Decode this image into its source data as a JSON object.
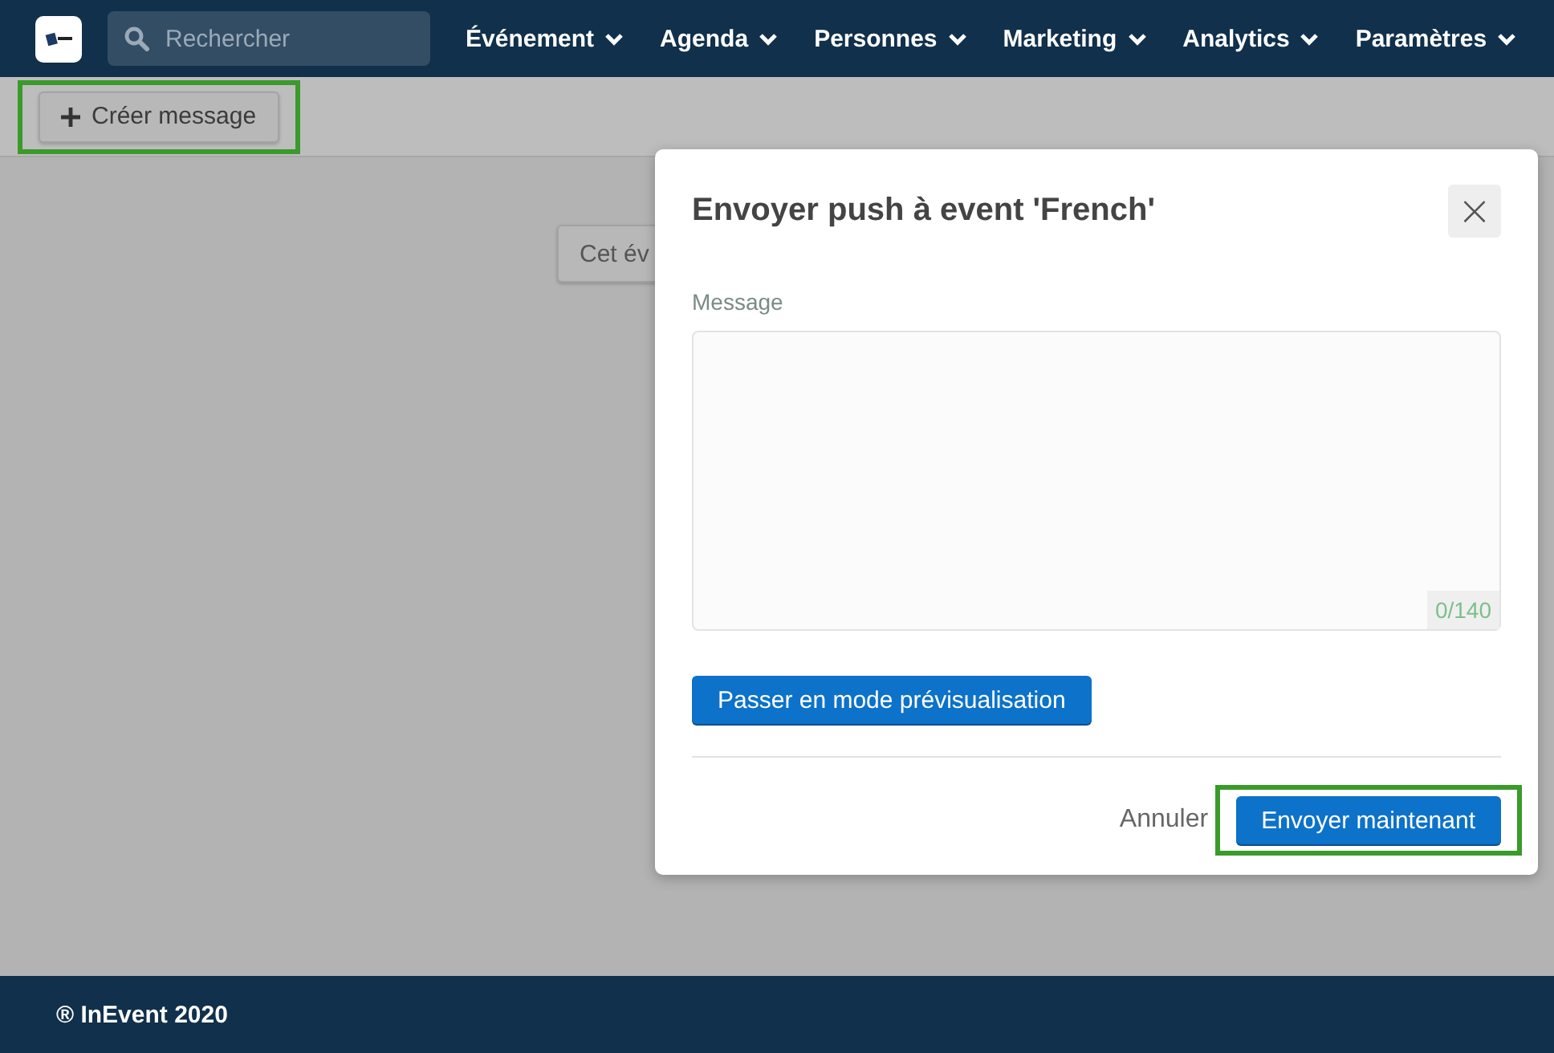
{
  "navbar": {
    "search": {
      "placeholder": "Rechercher"
    },
    "menus": [
      {
        "label": "Événement"
      },
      {
        "label": "Agenda"
      },
      {
        "label": "Personnes"
      },
      {
        "label": "Marketing"
      },
      {
        "label": "Analytics"
      },
      {
        "label": "Paramètres"
      }
    ]
  },
  "toolbar": {
    "create_button": {
      "label": "Créer message",
      "highlighted": true
    }
  },
  "background_button": {
    "label": "Cet év"
  },
  "dialog": {
    "title": "Envoyer push à event 'French'",
    "close_label": "×",
    "message": {
      "label": "Message",
      "counter": "0/140"
    },
    "preview_button": "Passer en mode prévisualisation",
    "cancel": "Annuler",
    "send": {
      "label": "Envoyer maintenant",
      "highlighted": true
    }
  },
  "footer": "® InEvent 2020"
}
